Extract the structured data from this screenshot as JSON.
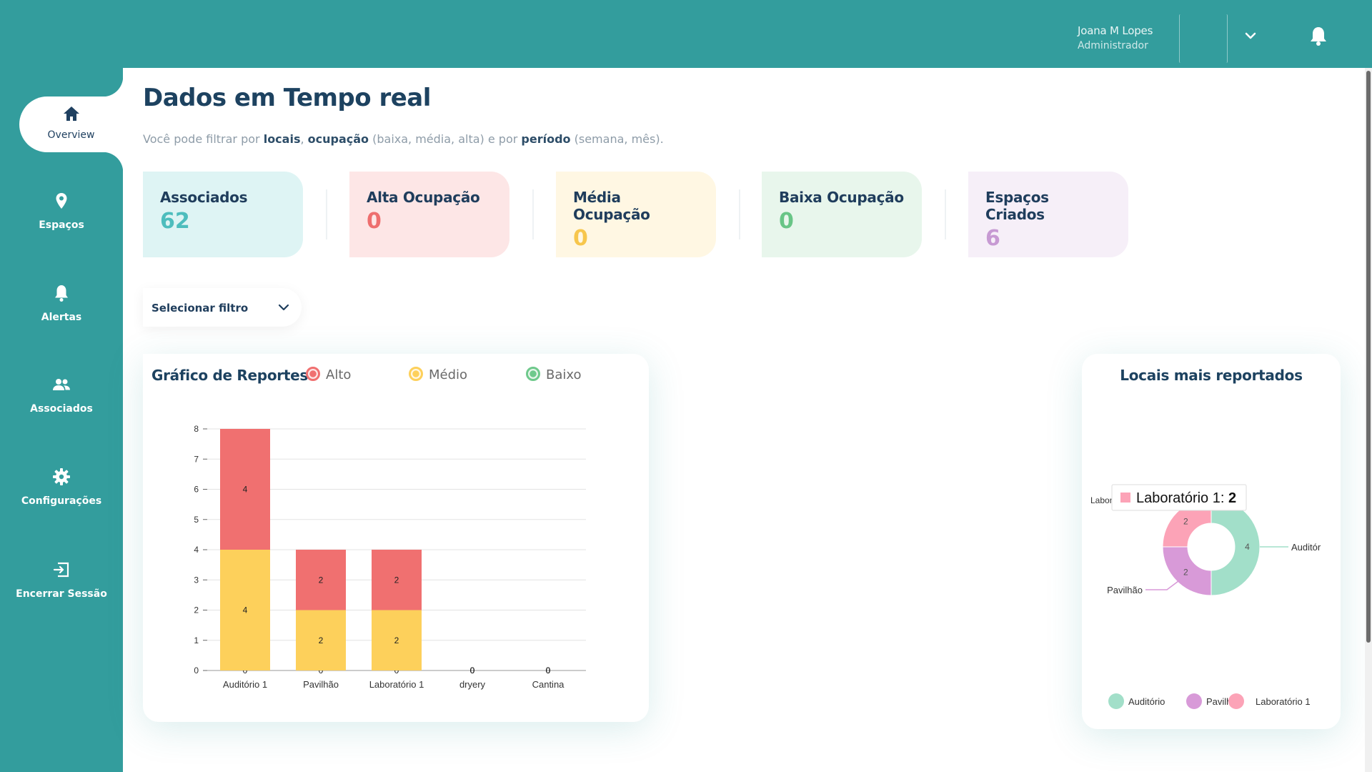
{
  "header": {
    "user_name": "Joana M Lopes",
    "user_role": "Administrador",
    "icons": [
      "chevron-down-icon",
      "bell-icon"
    ]
  },
  "sidebar": {
    "items": [
      {
        "label": "Overview",
        "icon": "home-icon",
        "active": true
      },
      {
        "label": "Espaços",
        "icon": "map-pin-icon",
        "active": false
      },
      {
        "label": "Alertas",
        "icon": "bell-icon",
        "active": false
      },
      {
        "label": "Associados",
        "icon": "users-icon",
        "active": false
      },
      {
        "label": "Configurações",
        "icon": "gear-icon",
        "active": false
      },
      {
        "label": "Encerrar Sessão",
        "icon": "logout-icon",
        "active": false
      }
    ]
  },
  "main": {
    "title": "Dados em Tempo real",
    "subtitle": {
      "t1": "Você pode filtrar por ",
      "b1": "locais",
      "t2": ", ",
      "b2": "ocupação",
      "t3": " (baixa, média, alta) e por ",
      "b3": "período",
      "t4": " (semana, mês)."
    },
    "cards": [
      {
        "label": "Associados",
        "value": "62",
        "bg": "#def4f4",
        "color": "#4dbdbd"
      },
      {
        "label": "Alta Ocupação",
        "value": "0",
        "bg": "#fde6e6",
        "color": "#ee6e6e"
      },
      {
        "label": "Média Ocupação",
        "value": "0",
        "bg": "#fff7e3",
        "color": "#f7c64c"
      },
      {
        "label": "Baixa Ocupação",
        "value": "0",
        "bg": "#e8f6ec",
        "color": "#68c586"
      },
      {
        "label": "Espaços Criados",
        "value": "6",
        "bg": "#f6eff8",
        "color": "#c79ad3"
      }
    ],
    "filter": {
      "label": "Selecionar filtro"
    }
  },
  "bar_chart": {
    "title": "Gráfico de Reportes",
    "legend": [
      {
        "label": "Alto",
        "color": "#f07070"
      },
      {
        "label": "Médio",
        "color": "#fdd05b"
      },
      {
        "label": "Baixo",
        "color": "#6fc98c"
      }
    ]
  },
  "donut_chart": {
    "title": "Locais mais reportados",
    "tooltip": {
      "label": "Laboratório 1: ",
      "value": "2",
      "color": "#fca3b7"
    },
    "slice_labels": {
      "left_top": "Laborat",
      "right": "Auditór",
      "left": "Pavilhão"
    },
    "legend": [
      {
        "label": "Auditório",
        "color": "#a2dfc9"
      },
      {
        "label": "Pavilhão",
        "color": "#d89ad8"
      },
      {
        "label": "Laboratório 1",
        "color": "#fca3b7"
      }
    ]
  },
  "chart_data": [
    {
      "type": "bar",
      "stacked": true,
      "title": "Gráfico de Reportes",
      "categories": [
        "Auditório 1",
        "Pavilhão",
        "Laboratório 1",
        "dryery",
        "Cantina"
      ],
      "series": [
        {
          "name": "Baixo",
          "values": [
            0,
            0,
            0,
            0,
            0
          ],
          "color": "#6fc98c"
        },
        {
          "name": "Médio",
          "values": [
            4,
            2,
            2,
            0,
            0
          ],
          "color": "#fdd05b"
        },
        {
          "name": "Alto",
          "values": [
            4,
            2,
            2,
            0,
            0
          ],
          "color": "#f07070"
        }
      ],
      "y_ticks": [
        0,
        1,
        2,
        3,
        4,
        5,
        6,
        7,
        8
      ],
      "ylim": [
        0,
        8
      ],
      "grid": true,
      "legend": "top"
    },
    {
      "type": "pie",
      "donut": true,
      "title": "Locais mais reportados",
      "slices": [
        {
          "name": "Auditório",
          "value": 4,
          "color": "#a2dfc9"
        },
        {
          "name": "Pavilhão",
          "value": 2,
          "color": "#d89ad8"
        },
        {
          "name": "Laboratório 1",
          "value": 2,
          "color": "#fca3b7"
        }
      ],
      "legend": "bottom"
    }
  ]
}
